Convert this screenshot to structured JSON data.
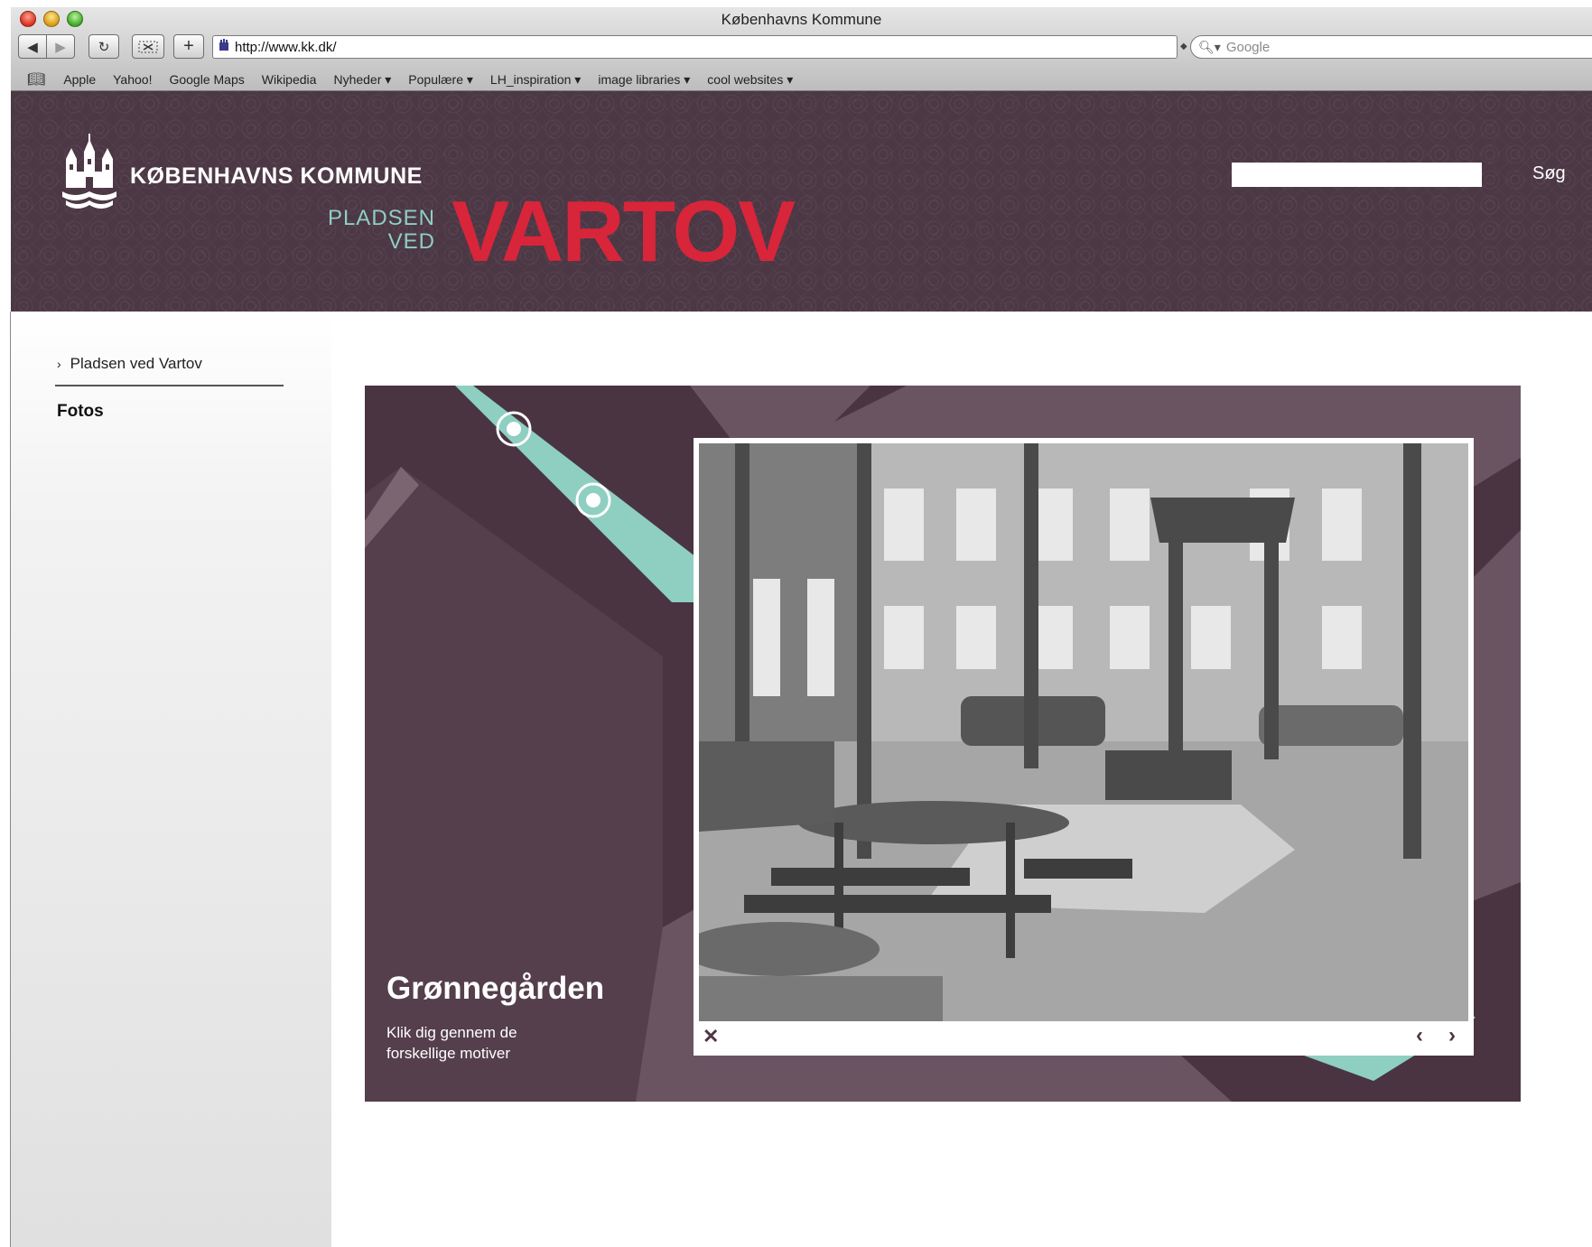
{
  "browser": {
    "window_title": "Københavns Kommune",
    "url": "http://www.kk.dk/",
    "search_placeholder": "Google",
    "bookmarks": [
      "Apple",
      "Yahoo!",
      "Google Maps",
      "Wikipedia",
      "Nyheder ▾",
      "Populære ▾",
      "LH_inspiration ▾",
      "image libraries ▾",
      "cool websites ▾"
    ],
    "icons": {
      "back": "back-arrow-icon",
      "forward": "forward-arrow-icon",
      "reload": "reload-icon",
      "bookmarks": "book-icon",
      "search": "magnifier-icon"
    }
  },
  "header": {
    "org_name": "KØBENHAVNS KOMMUNE",
    "place_line1": "PLADSEN",
    "place_line2": "VED",
    "place_big": "VARTOV",
    "search_button": "Søg",
    "colors": {
      "background": "#4c3744",
      "accent_red": "#d8253a",
      "accent_teal": "#8ecfc1"
    }
  },
  "sidebar": {
    "breadcrumb": "Pladsen ved Vartov",
    "active_item": "Fotos"
  },
  "gallery": {
    "caption_title": "Grønnegården",
    "caption_text": "Klik dig gennem de forskellige motiver",
    "controls": {
      "close": "✕",
      "prev": "‹",
      "next": "›"
    },
    "colors": {
      "panel": "#6a5462",
      "dark": "#4a3441",
      "teal": "#8ecfc1"
    }
  }
}
